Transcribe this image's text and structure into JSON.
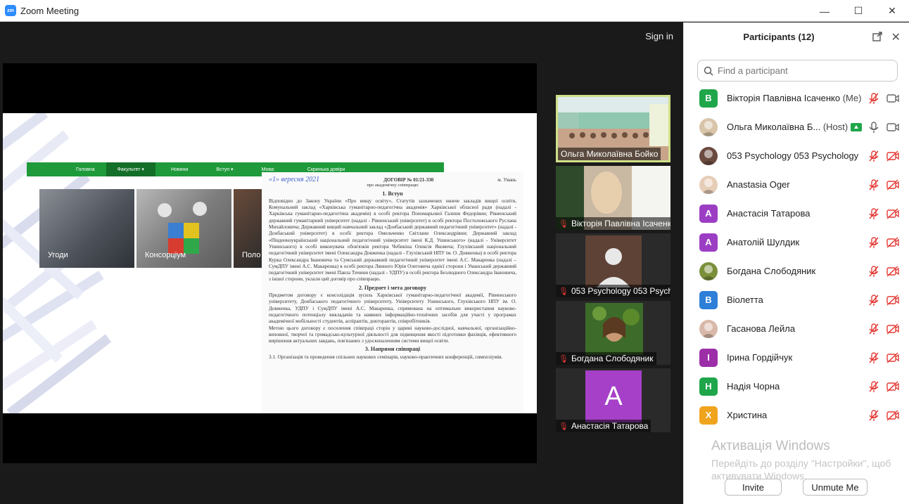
{
  "window": {
    "logo_text": "zm",
    "title": "Zoom Meeting",
    "minimize": "—",
    "maximize": "☐",
    "close": "✕"
  },
  "stage": {
    "signin": "Sign in"
  },
  "slide": {
    "nav": [
      "Головна",
      "Факультет ▾",
      "Новини",
      "Вступ ▾",
      "Мова:",
      "Скринька довіри"
    ],
    "tiles": [
      "Угоди",
      "Консорціум",
      "Поло"
    ],
    "doc": {
      "date_hand": "«1» вересня 2021",
      "number": "ДОГОВІР № 01/21-330",
      "subtitle": "про академічну співпрацю",
      "city": "м. Умань",
      "h1": "1. Вступ",
      "p1": "Відповідно до Закону України «Про вищу освіту», Статутів зазначених нижче закладів вищої освіти, Комунальний заклад «Харківська гуманітарно-педагогічна академія» Харківської обласної ради (надалі - Харківська гуманітарно-педагогічна академія) в особі ректора Пономарьової Галини Федорівни; Рівненський державний гуманітарний університет (надалі - Рівненський університет) в особі ректора Постоловського Руслана Михайловича; Державний вищий навчальний заклад «Донбаський державний педагогічний університет» (надалі - Донбаський університет) в особі ректора Омельченко Світлани Олександрівни; Державний заклад «Південноукраїнський національний педагогічний університет імені К.Д. Ушинського» (надалі - Університет Ушинського) в особі виконувача обов'язків ректора Чебикіна Олексія Яковича; Глухівський національний педагогічний університет імені Олександра Довженка (надалі - Глухівський НПУ ім. О. Довженка) в особі ректора Курка Олександра Івановича та Сумський державний педагогічний університет імені А.С. Макаренка (надалі – СумДПУ імені А.С. Макаренка) в особі ректора Лянного Юрія Олеговича однієї сторони і Уманський державний педагогічний університет імені Павла Тичини (надалі - УДПУ) в особі ректора Безлюдного Олександра Івановича, з іншої сторони, уклали цей договір про співпрацю.",
      "h2": "2. Предмет і мета договору",
      "p2": "Предметом договору є консолідація зусиль Харківської гуманітарно-педагогічної академії, Рівненського університету, Донбаського педагогічного університету, Університету Ушинського, Глухівського НПУ ім. О. Довженка, УДПУ і СумДПУ імені А.С. Макаренка, спрямована на оптимальне використання науково-педагогічного потенціалу викладачів та наявних інформаційно-технічних засобів для участі у програмах академічної мобільності студентів, аспірантів, докторантів, співробітників.",
      "p3": "Метою цього договору є посилення співпраці сторін у царині науково-дослідної, навчальної, організаційно-виховної, творчої та громадсько-культурної діяльності для підвищення якості підготовки фахівців, ефективного вирішення актуальних завдань, пов'язаних з удосконаленням системи вищої освіти.",
      "h3": "3. Напрями співпраці",
      "p4": "3.1. Організація та проведення спільних наукових семінарів, науково-практичних конференцій, симпозіумів."
    }
  },
  "thumbnails": [
    {
      "name": "Ольга Миколаївна Бойко",
      "muted": false,
      "active": true
    },
    {
      "name": "Вікторія Павлівна Ісаченко",
      "muted": true,
      "active": false
    },
    {
      "name": "053 Psychology 053 Psychology",
      "muted": true,
      "active": false
    },
    {
      "name": "Богдана Слободяник",
      "muted": true,
      "active": false
    },
    {
      "name": "Анастасія Татарова",
      "muted": true,
      "active": false,
      "initial": "A"
    }
  ],
  "panel": {
    "title": "Participants (12)",
    "search_placeholder": "Find a participant",
    "participants": [
      {
        "name": "Вікторія Павлівна Ісаченко",
        "tag": "(Me)",
        "initial": "B",
        "color": "#1fa64a",
        "mic": "muted",
        "cam": "on"
      },
      {
        "name": "Ольга Миколаївна Б...",
        "tag": "(Host)",
        "initial": "",
        "color": "#d8c4a8",
        "mic": "on",
        "cam": "on",
        "host": true
      },
      {
        "name": "053 Psychology 053 Psychology",
        "tag": "",
        "initial": "",
        "color": "#6b4a3f",
        "mic": "muted",
        "cam": "off"
      },
      {
        "name": "Anastasia Oger",
        "tag": "",
        "initial": "",
        "color": "#e6cdb7",
        "mic": "muted",
        "cam": "off"
      },
      {
        "name": "Анастасія Татарова",
        "tag": "",
        "initial": "A",
        "color": "#9c3ec4",
        "mic": "muted",
        "cam": "off"
      },
      {
        "name": "Анатолій Шулдик",
        "tag": "",
        "initial": "A",
        "color": "#9c3ec4",
        "mic": "muted",
        "cam": "off"
      },
      {
        "name": "Богдана Слободяник",
        "tag": "",
        "initial": "",
        "color": "#7a8f3a",
        "mic": "muted",
        "cam": "off"
      },
      {
        "name": "Віолетта",
        "tag": "",
        "initial": "B",
        "color": "#2d7fd8",
        "mic": "muted",
        "cam": "off"
      },
      {
        "name": "Гасанова Лейла",
        "tag": "",
        "initial": "",
        "color": "#d8b8a8",
        "mic": "muted",
        "cam": "off"
      },
      {
        "name": "Ірина Гордійчук",
        "tag": "",
        "initial": "I",
        "color": "#9c2ea8",
        "mic": "muted",
        "cam": "off"
      },
      {
        "name": "Надія Чорна",
        "tag": "",
        "initial": "H",
        "color": "#1fa64a",
        "mic": "muted",
        "cam": "off"
      },
      {
        "name": "Христина",
        "tag": "",
        "initial": "X",
        "color": "#f0a41e",
        "mic": "muted",
        "cam": "off"
      }
    ],
    "watermark_title": "Активація Windows",
    "watermark_text": "Перейдіть до розділу \"Настройки\", щоб активувати Windows.",
    "invite": "Invite",
    "unmute": "Unmute Me"
  }
}
